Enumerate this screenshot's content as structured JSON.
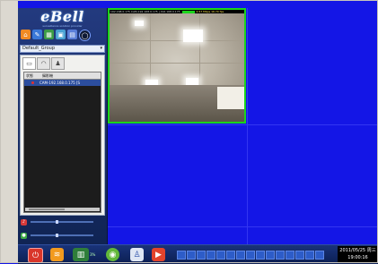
{
  "app": {
    "logo": "eBell",
    "logo_tagline": "surveillance solution provider"
  },
  "toolbar_icons": [
    "home-icon",
    "settings-icon",
    "record-icon",
    "display-icon",
    "playback-icon",
    "lock-icon"
  ],
  "group": {
    "selected": "Default_Group"
  },
  "camera_list": {
    "headers": [
      "状態",
      "攝影機"
    ],
    "rows": [
      {
        "name": "CAM-192.168.0.175 [S"
      }
    ]
  },
  "active_tile": {
    "header_left": "192.168.0.175   CAM-192.168.0.175 | 192.168.0.175",
    "header_right": "4.57 Mbps 16.70 fps"
  },
  "taskbar": {
    "cpu": "3%",
    "clock_date": "2011/05/25 周三",
    "clock_time": "19:00:16"
  },
  "colors": {
    "grid_bg": "#1416e6",
    "active_border": "#1bd41b",
    "panel_bg": "#102454"
  }
}
